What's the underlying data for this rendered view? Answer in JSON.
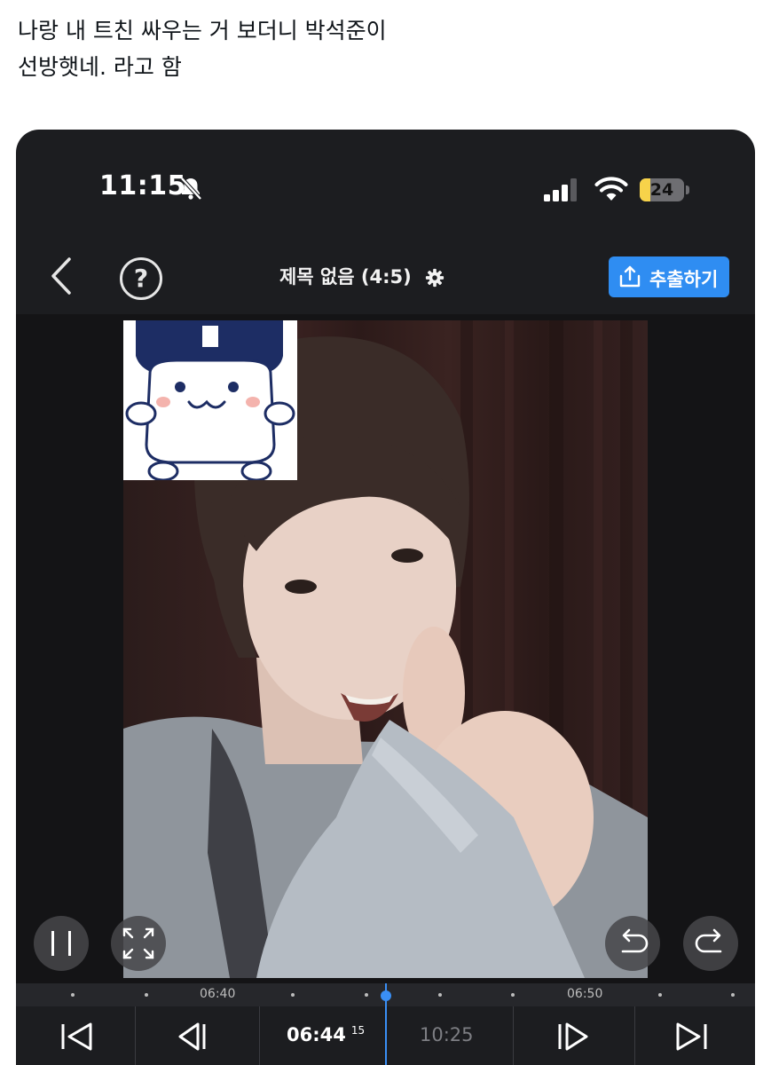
{
  "tweet": {
    "line1": "나랑 내 트친 싸우는 거 보더니 박석준이",
    "line2": "선방햇네. 라고 함"
  },
  "status_bar": {
    "time": "11:15",
    "battery_label": "24",
    "battery_level_percent": 24,
    "icons": [
      "bell-slash-icon",
      "signal-icon",
      "wifi-icon",
      "battery-icon"
    ]
  },
  "nav": {
    "back_icon": "chevron-left-icon",
    "help_label": "?",
    "title": "제목 없음 (4:5)",
    "title_icon": "gear-icon",
    "extract_label": "추출하기",
    "extract_icon": "share-icon"
  },
  "timeline": {
    "marker_left": "06:40",
    "marker_right": "06:50",
    "current_time": "06:44",
    "current_frame": "15",
    "total_time": "10:25"
  },
  "controls": {
    "icons": [
      "pause-icon",
      "fullscreen-icon",
      "undo-icon",
      "redo-icon",
      "skip-start-icon",
      "step-back-icon",
      "step-forward-icon",
      "skip-end-icon"
    ]
  },
  "colors": {
    "accent": "#2f8df2",
    "playhead": "#3a8ff5",
    "battery": "#f7d34a"
  }
}
